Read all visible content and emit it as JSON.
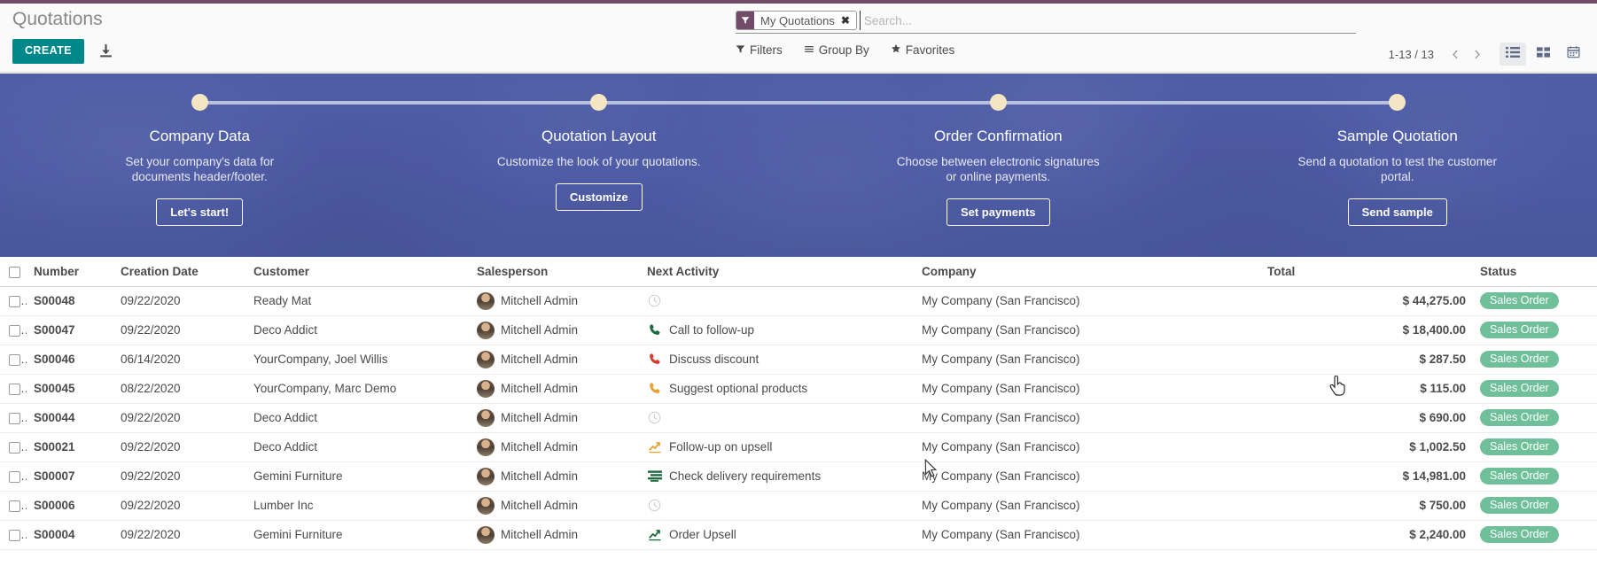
{
  "header": {
    "breadcrumb_title": "Quotations",
    "create_label": "CREATE",
    "import_icon": "import-icon"
  },
  "search": {
    "facet_icon": "filter-icon",
    "facet_label": "My Quotations",
    "facet_close": "✖",
    "placeholder": "Search...",
    "value": ""
  },
  "filter_bar": {
    "filters_label": "Filters",
    "filters_icon": "filter-funnel-icon",
    "groupby_label": "Group By",
    "groupby_icon": "bars-icon",
    "favorites_label": "Favorites",
    "favorites_icon": "star-icon"
  },
  "pager": {
    "value": "1-13 / 13",
    "prev_icon": "chevron-left-icon",
    "next_icon": "chevron-right-icon"
  },
  "view_switcher": {
    "views": [
      {
        "name": "list-view-button",
        "icon": "list-icon",
        "active": true
      },
      {
        "name": "kanban-view-button",
        "icon": "kanban-icon",
        "active": false
      },
      {
        "name": "calendar-view-button",
        "icon": "calendar-icon",
        "active": false
      }
    ]
  },
  "banner": {
    "steps": [
      {
        "title": "Company Data",
        "description": "Set your company's data for documents header/footer.",
        "button": "Let's start!"
      },
      {
        "title": "Quotation Layout",
        "description": "Customize the look of your quotations.",
        "button": "Customize"
      },
      {
        "title": "Order Confirmation",
        "description": "Choose between electronic signatures or online payments.",
        "button": "Set payments"
      },
      {
        "title": "Sample Quotation",
        "description": "Send a quotation to test the customer portal.",
        "button": "Send sample"
      }
    ]
  },
  "table": {
    "columns": [
      "Number",
      "Creation Date",
      "Customer",
      "Salesperson",
      "Next Activity",
      "Company",
      "Total",
      "Status"
    ],
    "rows": [
      {
        "number": "S00048",
        "creation_date": "09/22/2020",
        "customer": "Ready Mat",
        "salesperson": "Mitchell Admin",
        "activity": "",
        "activity_icon": "clock-icon",
        "activity_color": "#cfcfcf",
        "company": "My Company (San Francisco)",
        "total": "$ 44,275.00",
        "status": "Sales Order"
      },
      {
        "number": "S00047",
        "creation_date": "09/22/2020",
        "customer": "Deco Addict",
        "salesperson": "Mitchell Admin",
        "activity": "Call to follow-up",
        "activity_icon": "phone-icon",
        "activity_color": "#1d6b3e",
        "company": "My Company (San Francisco)",
        "total": "$ 18,400.00",
        "status": "Sales Order"
      },
      {
        "number": "S00046",
        "creation_date": "06/14/2020",
        "customer": "YourCompany, Joel Willis",
        "salesperson": "Mitchell Admin",
        "activity": "Discuss discount",
        "activity_icon": "phone-icon",
        "activity_color": "#d9382f",
        "company": "My Company (San Francisco)",
        "total": "$ 287.50",
        "status": "Sales Order"
      },
      {
        "number": "S00045",
        "creation_date": "08/22/2020",
        "customer": "YourCompany, Marc Demo",
        "salesperson": "Mitchell Admin",
        "activity": "Suggest optional products",
        "activity_icon": "phone-icon",
        "activity_color": "#e8a033",
        "company": "My Company (San Francisco)",
        "total": "$ 115.00",
        "status": "Sales Order"
      },
      {
        "number": "S00044",
        "creation_date": "09/22/2020",
        "customer": "Deco Addict",
        "salesperson": "Mitchell Admin",
        "activity": "",
        "activity_icon": "clock-icon",
        "activity_color": "#cfcfcf",
        "company": "My Company (San Francisco)",
        "total": "$ 690.00",
        "status": "Sales Order"
      },
      {
        "number": "S00021",
        "creation_date": "09/22/2020",
        "customer": "Deco Addict",
        "salesperson": "Mitchell Admin",
        "activity": "Follow-up on upsell",
        "activity_icon": "chart-line-icon",
        "activity_color": "#e8a033",
        "company": "My Company (San Francisco)",
        "total": "$ 1,002.50",
        "status": "Sales Order"
      },
      {
        "number": "S00007",
        "creation_date": "09/22/2020",
        "customer": "Gemini Furniture",
        "salesperson": "Mitchell Admin",
        "activity": "Check delivery requirements",
        "activity_icon": "list-lines-icon",
        "activity_color": "#1d6b3e",
        "company": "My Company (San Francisco)",
        "total": "$ 14,981.00",
        "status": "Sales Order"
      },
      {
        "number": "S00006",
        "creation_date": "09/22/2020",
        "customer": "Lumber Inc",
        "salesperson": "Mitchell Admin",
        "activity": "",
        "activity_icon": "clock-icon",
        "activity_color": "#cfcfcf",
        "company": "My Company (San Francisco)",
        "total": "$ 750.00",
        "status": "Sales Order"
      },
      {
        "number": "S00004",
        "creation_date": "09/22/2020",
        "customer": "Gemini Furniture",
        "salesperson": "Mitchell Admin",
        "activity": "Order Upsell",
        "activity_icon": "chart-line-icon",
        "activity_color": "#1d6b3e",
        "company": "My Company (San Francisco)",
        "total": "$ 2,240.00",
        "status": "Sales Order"
      }
    ]
  },
  "colors": {
    "accent": "#714b67",
    "create_button": "#00878a",
    "banner_bg": "#4e5ba6",
    "badge_green": "#6fc09a"
  }
}
